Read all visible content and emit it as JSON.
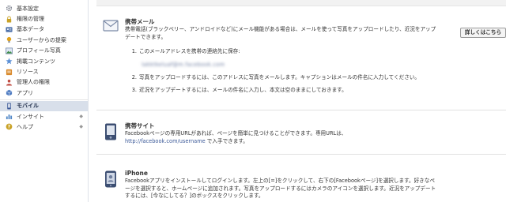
{
  "sidebar": {
    "items": [
      {
        "label": "基本設定",
        "icon": "gear-icon",
        "color": "#7a7f8c",
        "chevron": false,
        "active": false
      },
      {
        "label": "権限の管理",
        "icon": "lock-icon",
        "color": "#c9a227",
        "chevron": false,
        "active": false
      },
      {
        "label": "基本データ",
        "icon": "id-card-icon",
        "color": "#4a6ea8",
        "chevron": false,
        "active": false
      },
      {
        "label": "ユーザーからの提案",
        "icon": "lightbulb-icon",
        "color": "#e0a21c",
        "chevron": false,
        "active": false
      },
      {
        "label": "プロフィール写真",
        "icon": "photo-icon",
        "color": "#3f8f4a",
        "chevron": false,
        "active": false
      },
      {
        "label": "掲載コンテンツ",
        "icon": "star-icon",
        "color": "#5b8fd6",
        "chevron": false,
        "active": false
      },
      {
        "label": "リソース",
        "icon": "resource-icon",
        "color": "#d9892b",
        "chevron": false,
        "active": false
      },
      {
        "label": "管理人の権限",
        "icon": "admin-icon",
        "color": "#c04b41",
        "chevron": false,
        "active": false
      },
      {
        "label": "アプリ",
        "icon": "app-cube-icon",
        "color": "#4f7cc2",
        "chevron": false,
        "active": false
      },
      {
        "label": "モバイル",
        "icon": "mobile-icon",
        "color": "#3b5998",
        "chevron": false,
        "active": true
      },
      {
        "label": "インサイト",
        "icon": "chart-icon",
        "color": "#4f86c6",
        "chevron": true,
        "active": false
      },
      {
        "label": "ヘルプ",
        "icon": "help-icon",
        "color": "#c9a227",
        "chevron": true,
        "active": false
      }
    ],
    "chevron_glyph": "◆"
  },
  "main": {
    "email_section": {
      "title": "携帯メール",
      "icon": "envelope-icon",
      "description": "携帯電話(ブラックベリー、アンドロイドなど)にメール機能がある場合は、メールを使って写真をアップロードしたり、近況をアップデートできます。",
      "details_button": "詳しくはこちら",
      "steps": [
        {
          "num": "1.",
          "text": "このメールアドレスを携帯の連絡先に保存:"
        },
        {
          "num": "2.",
          "text": "写真をアップロードするには、このアドレスに写真をメールします。キャプションはメールの件名に入力してください。"
        },
        {
          "num": "3.",
          "text": "近況をアップデートするには、メールの件名に入力し、本文は空のままにしておきます。"
        }
      ],
      "email_address": "lakktkeluaf@m.facebook.com"
    },
    "mobile_site_section": {
      "title": "携帯サイト",
      "icon": "phone-icon",
      "description_1": "Facebookページの専用URLがあれば、ページを簡単に見つけることができます。専用URLは、",
      "link": "http://facebook.com/username",
      "description_2": " で入手できます。"
    },
    "iphone_section": {
      "title": "iPhone",
      "icon": "iphone-icon",
      "description": "Facebookアプリをインストールしてログインします。左上の[=]をクリックして、右下の[Facebookページ]を選択します。好きなページを選択すると、ホームページに追加されます。写真をアップロードするにはカメラのアイコンを選択します。近況をアップデートするには、[今なにしてる？]のボックスをクリックします。"
    }
  }
}
